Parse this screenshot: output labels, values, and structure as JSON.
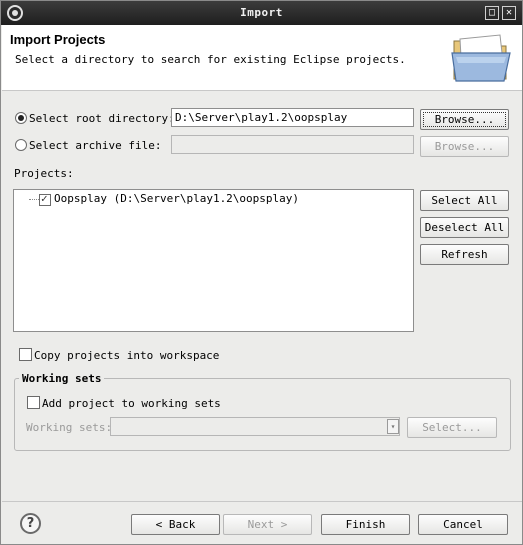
{
  "window": {
    "title": "Import"
  },
  "header": {
    "title": "Import Projects",
    "description": "Select a directory to search for existing Eclipse projects."
  },
  "source": {
    "root_label": "Select root directory:",
    "root_path": "D:\\Server\\play1.2\\oopsplay",
    "archive_label": "Select archive file:",
    "archive_path": "",
    "selected": "root",
    "browse_label": "Browse...",
    "browse2_label": "Browse..."
  },
  "projects": {
    "label": "Projects:",
    "items": [
      {
        "name": "Oopsplay (D:\\Server\\play1.2\\oopsplay)",
        "checked": true
      }
    ],
    "select_all": "Select All",
    "deselect_all": "Deselect All",
    "refresh": "Refresh"
  },
  "copy_into_workspace": {
    "label": "Copy projects into workspace",
    "checked": false
  },
  "working_sets": {
    "title": "Working sets",
    "add_label": "Add project to working sets",
    "add_checked": false,
    "sets_label": "Working sets:",
    "sets_value": "",
    "select_label": "Select..."
  },
  "footer": {
    "back": "< Back",
    "next": "Next >",
    "finish": "Finish",
    "cancel": "Cancel"
  }
}
